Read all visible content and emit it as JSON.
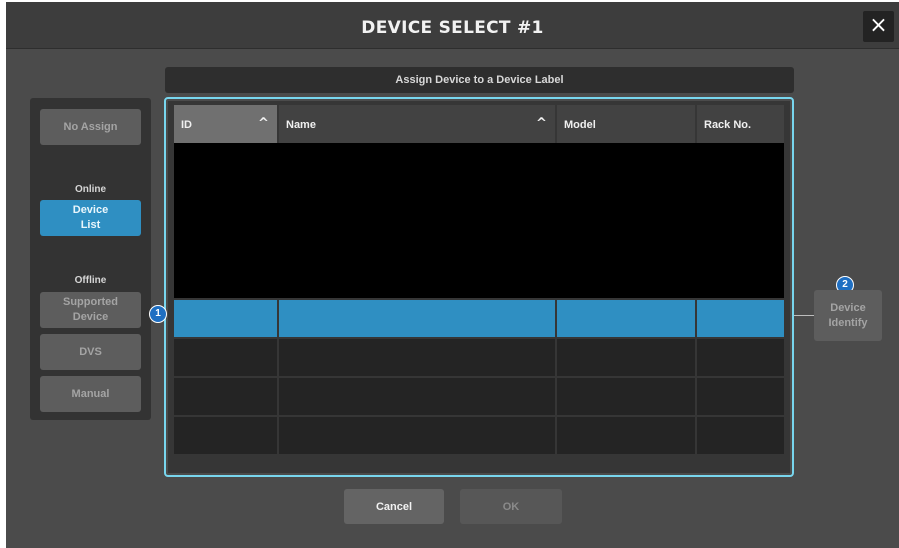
{
  "dialog": {
    "title": "DEVICE SELECT #1",
    "close_icon": "×"
  },
  "assign_bar": {
    "label": "Assign Device to a Device Label"
  },
  "left_panel": {
    "no_assign": "No Assign",
    "online_label": "Online",
    "device_list": "Device\nList",
    "offline_label": "Offline",
    "supported_device": "Supported\nDevice",
    "dvs": "DVS",
    "manual": "Manual"
  },
  "table": {
    "columns": [
      {
        "label": "ID",
        "sort": "^"
      },
      {
        "label": "Name",
        "sort": "^"
      },
      {
        "label": "Model"
      },
      {
        "label": "Rack No."
      }
    ],
    "rows": [
      [
        "",
        "",
        "",
        ""
      ],
      [
        "",
        "",
        "",
        ""
      ],
      [
        "",
        "",
        "",
        ""
      ],
      [
        "",
        "",
        "",
        ""
      ]
    ],
    "selected_row": 0
  },
  "callouts": {
    "table": "1",
    "identify": "2"
  },
  "device_identify": {
    "label": "Device\nIdentify"
  },
  "footer": {
    "cancel": "Cancel",
    "ok": "OK"
  },
  "colors": {
    "accent": "#2f8fc2",
    "frame": "#78d6ee",
    "callout": "#1f6fc2"
  }
}
